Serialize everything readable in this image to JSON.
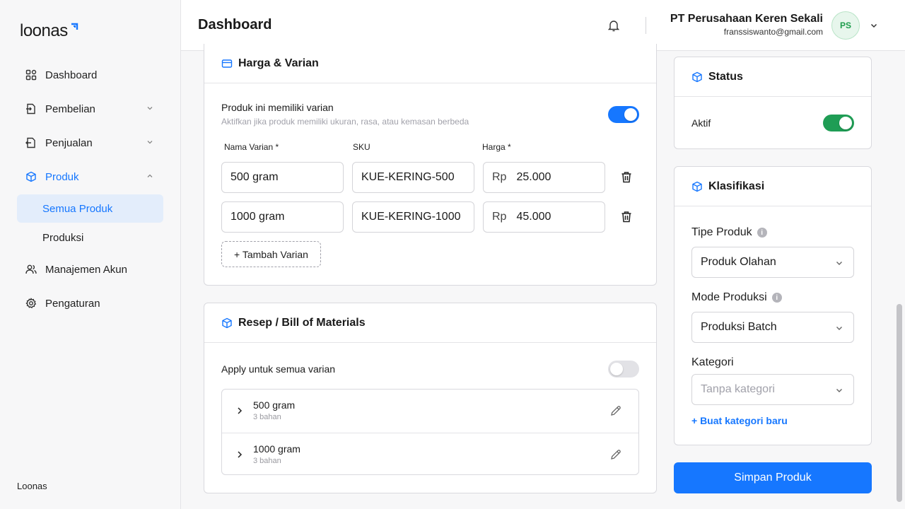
{
  "sidebar": {
    "logo": "loonas",
    "items": [
      {
        "label": "Dashboard"
      },
      {
        "label": "Pembelian"
      },
      {
        "label": "Penjualan"
      },
      {
        "label": "Produk"
      },
      {
        "label": "Semua Produk"
      },
      {
        "label": "Produksi"
      },
      {
        "label": "Manajemen Akun"
      },
      {
        "label": "Pengaturan"
      }
    ],
    "footer": "Loonas"
  },
  "header": {
    "title": "Dashboard",
    "company_name": "PT Perusahaan Keren Sekali",
    "email": "franssiswanto@gmail.com",
    "avatar_initials": "PS"
  },
  "harga": {
    "title": "Harga & Varian",
    "variant_toggle_label": "Produk ini memiliki varian",
    "variant_toggle_hint": "Aktifkan jika produk memiliki ukuran, rasa, atau kemasan berbeda",
    "variant_toggle_on": true,
    "col_nama": "Nama Varian *",
    "col_sku": "SKU",
    "col_harga": "Harga *",
    "currency": "Rp",
    "rows": [
      {
        "nama": "500 gram",
        "sku": "KUE-KERING-500",
        "harga": "25.000"
      },
      {
        "nama": "1000 gram",
        "sku": "KUE-KERING-1000",
        "harga": "45.000"
      }
    ],
    "add_label": "+ Tambah Varian"
  },
  "resep": {
    "title": "Resep / Bill of Materials",
    "apply_label": "Apply untuk semua varian",
    "apply_on": false,
    "items": [
      {
        "title": "500 gram",
        "sub": "3 bahan"
      },
      {
        "title": "1000 gram",
        "sub": "3 bahan"
      }
    ]
  },
  "status": {
    "title": "Status",
    "label": "Aktif",
    "on": true
  },
  "klasifikasi": {
    "title": "Klasifikasi",
    "tipe_label": "Tipe Produk",
    "tipe_value": "Produk Olahan",
    "mode_label": "Mode Produksi",
    "mode_value": "Produksi Batch",
    "kategori_label": "Kategori",
    "kategori_placeholder": "Tanpa kategori",
    "new_kategori_link": "+ Buat kategori baru"
  },
  "save_label": "Simpan Produk",
  "colors": {
    "accent": "#1677ff",
    "success": "#1f9d55"
  }
}
